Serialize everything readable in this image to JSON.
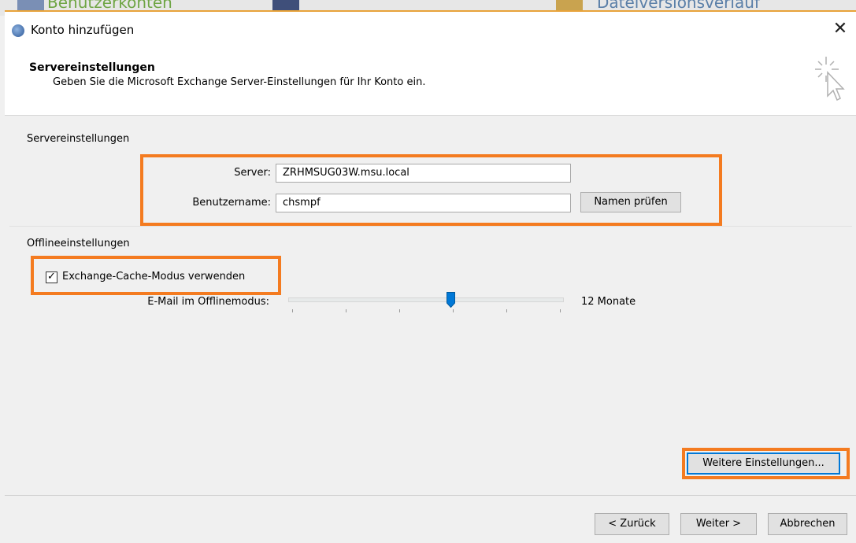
{
  "background": {
    "left_text": "Benutzerkonten",
    "right_text": "Dateiversionsverlauf"
  },
  "window": {
    "title": "Konto hinzufügen",
    "close_glyph": "✕"
  },
  "header": {
    "title": "Servereinstellungen",
    "subtitle": "Geben Sie die Microsoft Exchange Server-Einstellungen für Ihr Konto ein."
  },
  "server_section": {
    "label": "Servereinstellungen",
    "server_label": "Server:",
    "server_value": "ZRHMSUG03W.msu.local",
    "username_label": "Benutzername:",
    "username_value": "chsmpf",
    "check_names_button": "Namen prüfen"
  },
  "offline_section": {
    "label": "Offlineeinstellungen",
    "cache_mode_label": "Exchange-Cache-Modus verwenden",
    "cache_mode_checked": true,
    "slider_label": "E-Mail im Offlinemodus:",
    "slider_value_text": "12 Monate",
    "slider_fraction": 0.59
  },
  "more_settings_button": "Weitere Einstellungen...",
  "footer": {
    "back_button": "< Zurück",
    "next_button": "Weiter >",
    "cancel_button": "Abbrechen"
  },
  "colors": {
    "highlight": "#f47b20",
    "accent": "#0078d7"
  }
}
